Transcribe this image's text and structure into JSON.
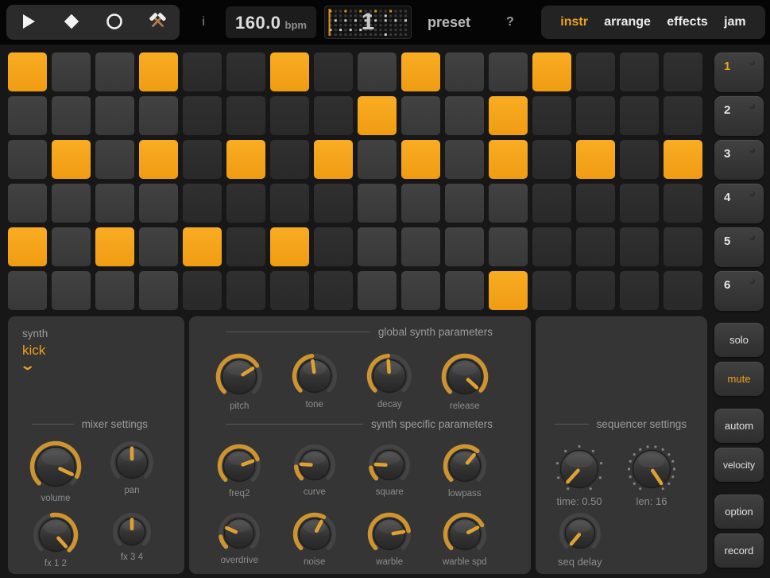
{
  "colors": {
    "accent": "#f2a01d",
    "cell_on": "#f6a41c",
    "knob_arc": "#cd9430",
    "knob_pointer": "#dfa132",
    "minimap_active_track": "#d6931c",
    "minimap_active_other": "#cfcfcf"
  },
  "topbar": {
    "transport": [
      {
        "id": "play",
        "icon": "play-icon"
      },
      {
        "id": "stop",
        "icon": "diamond-icon"
      },
      {
        "id": "record",
        "icon": "circle-icon"
      },
      {
        "id": "tools",
        "icon": "crossed-hammers-icon"
      }
    ],
    "info_label": "i",
    "bpm": {
      "value": "160.0",
      "unit": "bpm"
    },
    "pattern_display": {
      "number": "1",
      "playhead_step": 1
    },
    "preset_label": "preset",
    "help_label": "?",
    "tabs": [
      {
        "id": "instr",
        "label": "instr",
        "active": true
      },
      {
        "id": "arrange",
        "label": "arrange",
        "active": false
      },
      {
        "id": "effects",
        "label": "effects",
        "active": false
      },
      {
        "id": "jam",
        "label": "jam",
        "active": false
      }
    ]
  },
  "grid": {
    "columns": 16,
    "rows": 6,
    "active_pattern": [
      [
        1,
        4,
        7,
        10,
        13
      ],
      [
        9,
        12
      ],
      [
        2,
        4,
        6,
        8,
        10,
        12,
        14,
        16
      ],
      [],
      [
        1,
        3,
        5,
        7
      ],
      [
        12
      ]
    ]
  },
  "sidebar": {
    "tracks": [
      {
        "label": "1",
        "active": true
      },
      {
        "label": "2",
        "active": false
      },
      {
        "label": "3",
        "active": false
      },
      {
        "label": "4",
        "active": false
      },
      {
        "label": "5",
        "active": false
      },
      {
        "label": "6",
        "active": false
      }
    ],
    "modes": [
      {
        "id": "solo",
        "label": "solo",
        "active": false
      },
      {
        "id": "mute",
        "label": "mute",
        "active": true
      },
      {
        "id": "autom",
        "label": "autom",
        "active": false
      },
      {
        "id": "velocity",
        "label": "velocity",
        "active": false
      },
      {
        "id": "option",
        "label": "option",
        "active": false
      },
      {
        "id": "record",
        "label": "record",
        "active": false
      }
    ]
  },
  "panels": {
    "synth_select": {
      "label": "synth",
      "value": "kick"
    },
    "mixer": {
      "header": "mixer settings",
      "knobs": [
        {
          "id": "volume",
          "label": "volume",
          "size": 66,
          "arc_start": -135,
          "arc_end": 115,
          "pointer": 115
        },
        {
          "id": "pan",
          "label": "pan",
          "size": 56,
          "arc_start": null,
          "arc_end": null,
          "pointer": 0
        },
        {
          "id": "fx12",
          "label": "fx 1 2",
          "size": 58,
          "arc_start": -10,
          "arc_end": 138,
          "pointer": 138
        },
        {
          "id": "fx34",
          "label": "fx 3 4",
          "size": 50,
          "arc_start": null,
          "arc_end": null,
          "pointer": 0
        }
      ]
    },
    "global": {
      "header": "global synth parameters",
      "knobs": [
        {
          "id": "pitch",
          "label": "pitch",
          "size": 60,
          "arc_start": -135,
          "arc_end": 58,
          "pointer": 58
        },
        {
          "id": "tone",
          "label": "tone",
          "size": 58,
          "arc_start": -135,
          "arc_end": -8,
          "pointer": -8
        },
        {
          "id": "decay",
          "label": "decay",
          "size": 58,
          "arc_start": -135,
          "arc_end": -4,
          "pointer": -4
        },
        {
          "id": "release",
          "label": "release",
          "size": 60,
          "arc_start": -135,
          "arc_end": 130,
          "pointer": 132
        }
      ]
    },
    "specific": {
      "header": "synth specific parameters",
      "rows": [
        [
          {
            "id": "freq2",
            "label": "freq2",
            "size": 56,
            "arc_start": -135,
            "arc_end": 70,
            "pointer": 70
          },
          {
            "id": "curve",
            "label": "curve",
            "size": 54,
            "arc_start": -135,
            "arc_end": -95,
            "pointer": -86
          },
          {
            "id": "square",
            "label": "square",
            "size": 54,
            "arc_start": -135,
            "arc_end": -98,
            "pointer": -87
          },
          {
            "id": "lowpass",
            "label": "lowpass",
            "size": 56,
            "arc_start": -135,
            "arc_end": 40,
            "pointer": 40
          }
        ],
        [
          {
            "id": "overdrive",
            "label": "overdrive",
            "size": 54,
            "arc_start": -135,
            "arc_end": -100,
            "pointer": -66
          },
          {
            "id": "noise",
            "label": "noise",
            "size": 56,
            "arc_start": -135,
            "arc_end": 28,
            "pointer": 28
          },
          {
            "id": "warble",
            "label": "warble",
            "size": 56,
            "arc_start": -135,
            "arc_end": 80,
            "pointer": 80
          },
          {
            "id": "warble_spd",
            "label": "warble spd",
            "size": 56,
            "arc_start": -135,
            "arc_end": 62,
            "pointer": 62
          }
        ]
      ]
    },
    "sequencer_settings": {
      "header": "sequencer settings",
      "knobs": [
        {
          "id": "time",
          "label": "time: 0.50",
          "size": 64,
          "arc_start": null,
          "arc_end": null,
          "pointer": -138,
          "ticks": 9
        },
        {
          "id": "len",
          "label": "len: 16",
          "size": 64,
          "arc_start": null,
          "arc_end": null,
          "pointer": 146,
          "ticks": 16
        },
        {
          "id": "seq_delay",
          "label": "seq delay",
          "size": 54,
          "arc_start": null,
          "arc_end": null,
          "pointer": -140,
          "ticks": 0
        }
      ]
    }
  }
}
